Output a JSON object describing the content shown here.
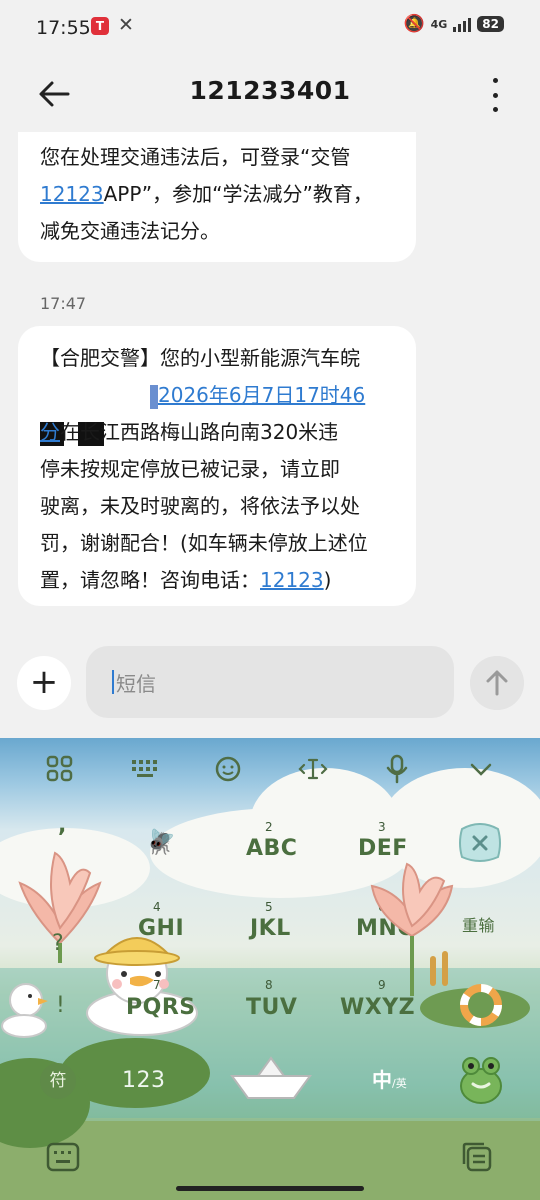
{
  "status_bar": {
    "time": "17:55",
    "app_badge": "T",
    "network": "4G",
    "battery": "82"
  },
  "header": {
    "title": "121233401"
  },
  "messages": {
    "first_partial_line": "…………………",
    "first_line1_a": "您在处理交通违法后，可登录“交管",
    "first_link": "12123",
    "first_line2_rest": "APP”，参加“学法减分”教育，",
    "first_line3": "减免交通违法记分。",
    "timestamp": "17:47",
    "second_line1": "【合肥交警】您的小型新能源汽车皖",
    "second_link_date": "2026年6月7日17时46",
    "second_link_min": "分",
    "second_line3_rest": "在长江西路梅山路向南320米违",
    "second_line4": "停未按规定停放已被记录，请立即",
    "second_line5": "驶离，未及时驶离的，将依法予以处",
    "second_line6": "罚，谢谢配合！(如车辆未停放上述位",
    "second_line7_a": "置，请忽略！咨询电话：",
    "second_phone": "12123",
    "second_line7_b": ")"
  },
  "input": {
    "placeholder": "短信"
  },
  "keyboard": {
    "keys": [
      {
        "num": "",
        "label": ","
      },
      {
        "num": "2",
        "label": "ABC"
      },
      {
        "num": "3",
        "label": "DEF"
      },
      {
        "num": "4",
        "label": "GHI"
      },
      {
        "num": "5",
        "label": "JKL"
      },
      {
        "num": "6",
        "label": "MNO"
      },
      {
        "num": "7",
        "label": "PQRS"
      },
      {
        "num": "8",
        "label": "TUV"
      },
      {
        "num": "9",
        "label": "WXYZ"
      }
    ],
    "side_question": "?",
    "side_exclaim": "!",
    "reenter": "重输",
    "symbols": "符",
    "numbers": "123",
    "lang_main": "中",
    "lang_sub": "/英"
  },
  "icons": {
    "back": "back-arrow-icon",
    "more": "more-vertical-icon",
    "add": "plus-icon",
    "send": "send-arrow-icon",
    "apps": "grid-icon",
    "kb": "keyboard-icon",
    "emoji": "emoji-icon",
    "cursor": "cursor-move-icon",
    "mic": "mic-icon",
    "collapse": "chevron-down-icon",
    "delete": "delete-icon",
    "space": "paper-boat-icon",
    "enter": "frog-enter-icon",
    "hide_kb": "hide-keyboard-icon",
    "clipboard": "clipboard-icon"
  },
  "colors": {
    "link": "#2f7bd0",
    "bubble": "#ffffff",
    "background": "#f1f1f1"
  }
}
